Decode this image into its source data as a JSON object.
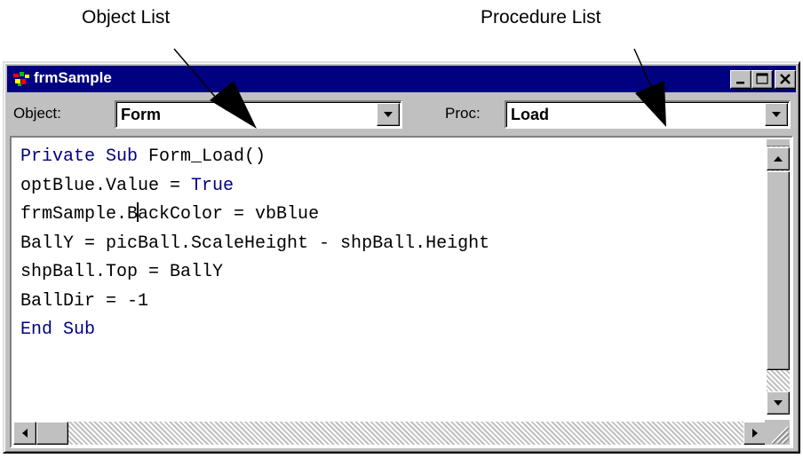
{
  "callouts": {
    "object_list": "Object List",
    "procedure_list": "Procedure List"
  },
  "window": {
    "title": "frmSample",
    "icon": "vb-form-icon",
    "title_buttons": [
      "minimize-icon",
      "maximize-icon",
      "close-icon"
    ],
    "title_bar_color": "#000080"
  },
  "object_combo": {
    "label": "Object:",
    "value": "Form"
  },
  "proc_combo": {
    "label": "Proc:",
    "value": "Load"
  },
  "code": {
    "lines": [
      {
        "segments": [
          {
            "text": "Private Sub",
            "kw": true
          },
          {
            "text": " Form_Load()",
            "kw": false
          }
        ]
      },
      {
        "segments": [
          {
            "text": "optBlue.Value = ",
            "kw": false
          },
          {
            "text": "True",
            "kw": true
          }
        ]
      },
      {
        "segments": [
          {
            "text": "frmSample.B",
            "kw": false
          },
          {
            "text": "",
            "caret": true
          },
          {
            "text": "ackColor = vbBlue",
            "kw": false
          }
        ]
      },
      {
        "segments": [
          {
            "text": "BallY = picBall.ScaleHeight - shpBall.Height",
            "kw": false
          }
        ]
      },
      {
        "segments": [
          {
            "text": "shpBall.Top = BallY",
            "kw": false
          }
        ]
      },
      {
        "segments": [
          {
            "text": "BallDir = -1",
            "kw": false
          }
        ]
      },
      {
        "segments": [
          {
            "text": "End Sub",
            "kw": true
          }
        ]
      }
    ],
    "keyword_color": "#000080",
    "text_color": "#000000"
  },
  "scrollbars": {
    "vertical": {
      "position": 0
    },
    "horizontal": {
      "position": 0
    }
  }
}
